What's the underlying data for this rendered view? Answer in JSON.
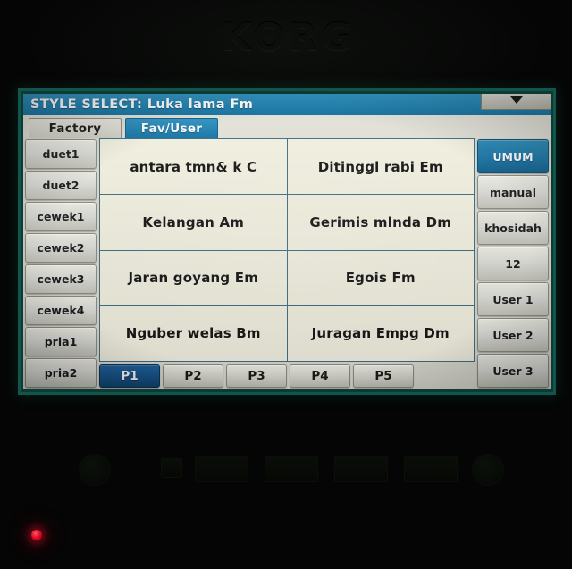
{
  "device": {
    "brand_logo": "KORG",
    "power_led": "power-led"
  },
  "screen": {
    "titlebar": {
      "title": "STYLE SELECT: Luka lama Fm",
      "dropdown_icon": "chevron-down-icon"
    },
    "top_tabs": [
      {
        "label": "Factory",
        "selected": false
      },
      {
        "label": "Fav/User",
        "selected": true
      }
    ],
    "left_banks": [
      {
        "label": "duet1",
        "selected": false
      },
      {
        "label": "duet2",
        "selected": false
      },
      {
        "label": "cewek1",
        "selected": false
      },
      {
        "label": "cewek2",
        "selected": false
      },
      {
        "label": "cewek3",
        "selected": false
      },
      {
        "label": "cewek4",
        "selected": false
      },
      {
        "label": "pria1",
        "selected": false
      },
      {
        "label": "pria2",
        "selected": false
      }
    ],
    "right_banks": [
      {
        "label": "UMUM",
        "selected": true
      },
      {
        "label": "manual",
        "selected": false
      },
      {
        "label": "khosidah",
        "selected": false
      },
      {
        "label": "12",
        "selected": false
      },
      {
        "label": "User 1",
        "selected": false
      },
      {
        "label": "User 2",
        "selected": false
      },
      {
        "label": "User 3",
        "selected": false
      }
    ],
    "style_grid": [
      {
        "label": "antara tmn& k C",
        "selected": false
      },
      {
        "label": "Ditinggl rabi Em",
        "selected": false
      },
      {
        "label": "Kelangan Am",
        "selected": false
      },
      {
        "label": "Gerimis mlnda Dm",
        "selected": false
      },
      {
        "label": "Jaran goyang Em",
        "selected": false
      },
      {
        "label": "Egois Fm",
        "selected": false
      },
      {
        "label": "Nguber welas Bm",
        "selected": false
      },
      {
        "label": "Juragan Empg Dm",
        "selected": false
      }
    ],
    "page_tabs": [
      {
        "label": "P1",
        "selected": true
      },
      {
        "label": "P2",
        "selected": false
      },
      {
        "label": "P3",
        "selected": false
      },
      {
        "label": "P4",
        "selected": false
      },
      {
        "label": "P5",
        "selected": false
      }
    ]
  },
  "colors": {
    "titlebar_blue": "#1a7fae",
    "tab_selected_blue": "#1274a6",
    "bank_selected_blue": "#1a76a8",
    "page_selected_blue": "#17538a",
    "cell_background": "#f4f2e2",
    "grid_line": "#3e6f86",
    "screen_bezel": "#10564a",
    "led_red": "#e00d28"
  }
}
